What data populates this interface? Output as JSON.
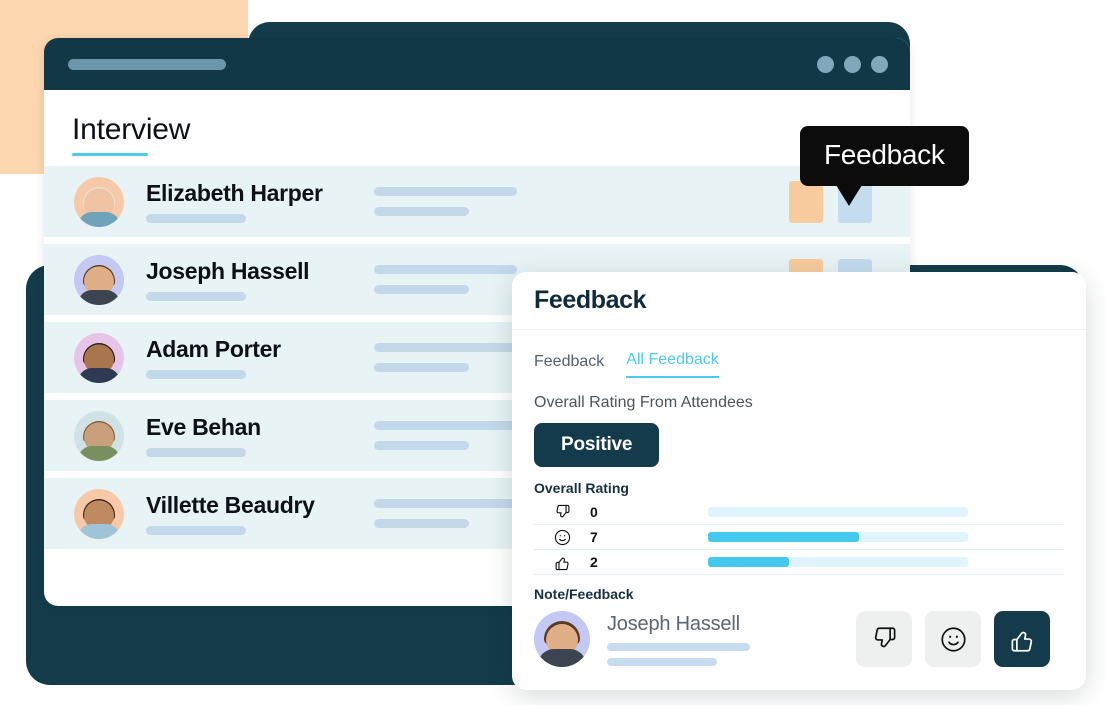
{
  "background": {
    "peach_color": "#fbd6af",
    "navy_color": "#133b4a"
  },
  "app_window": {
    "titlebar": {
      "dots_label": "window-controls",
      "accent_bar_color": "#6d96ab"
    },
    "page_title": "Interview",
    "title_underline_color": "#4ec9ef",
    "list": [
      {
        "name": "Elizabeth Harper",
        "hair": "#e8e2d5",
        "skin": "#f0c3a4",
        "body": "#6fa3ba",
        "bg": "#f7c9a8"
      },
      {
        "name": "Joseph Hassell",
        "hair": "#5a3a22",
        "skin": "#e0ae87",
        "body": "#3b4450",
        "bg": "#c3c9f3"
      },
      {
        "name": "Adam Porter",
        "hair": "#2b1d15",
        "skin": "#a9estimate",
        "body": "#2d3a52",
        "bg": "#e6c5e8"
      },
      {
        "name": "Eve Behan",
        "hair": "#8a5a34",
        "skin": "#caa07c",
        "body": "#7a8f5f",
        "bg": "#cfe3e6"
      },
      {
        "name": "Villette Beaudry",
        "hair": "#3a2418",
        "skin": "#c08a60",
        "body": "#9fc4d8",
        "bg": "#f7c9a8"
      }
    ],
    "tile_colors": {
      "orange": "#f8cb9e",
      "blue": "#c3dcef"
    }
  },
  "tooltip": {
    "label": "Feedback"
  },
  "panel": {
    "title": "Feedback",
    "tabs": [
      {
        "label": "Feedback",
        "active": false
      },
      {
        "label": "All Feedback",
        "active": true
      }
    ],
    "overall_rating_from_attendees_label": "Overall Rating From Attendees",
    "overall_sentiment": "Positive",
    "overall_rating_label": "Overall Rating",
    "note_label": "Note/Feedback",
    "note": {
      "name": "Joseph Hassell",
      "actions": [
        {
          "icon": "thumbs-down-icon",
          "selected": false
        },
        {
          "icon": "smiley-icon",
          "selected": false
        },
        {
          "icon": "thumbs-up-icon",
          "selected": true
        }
      ]
    },
    "accent_color": "#4ec9ef",
    "dark_color": "#143b4c"
  },
  "chart_data": {
    "type": "bar",
    "title": "Overall Rating",
    "orientation": "horizontal",
    "categories": [
      "thumbs-down-icon",
      "smiley-icon",
      "thumbs-up-icon"
    ],
    "values": [
      0,
      7,
      2
    ],
    "percents": [
      0,
      58,
      31
    ],
    "bar_color": "#45c8ee",
    "track_color": "#dff4fc",
    "xlabel": "",
    "ylabel": "",
    "grid": false,
    "legend": "none"
  }
}
